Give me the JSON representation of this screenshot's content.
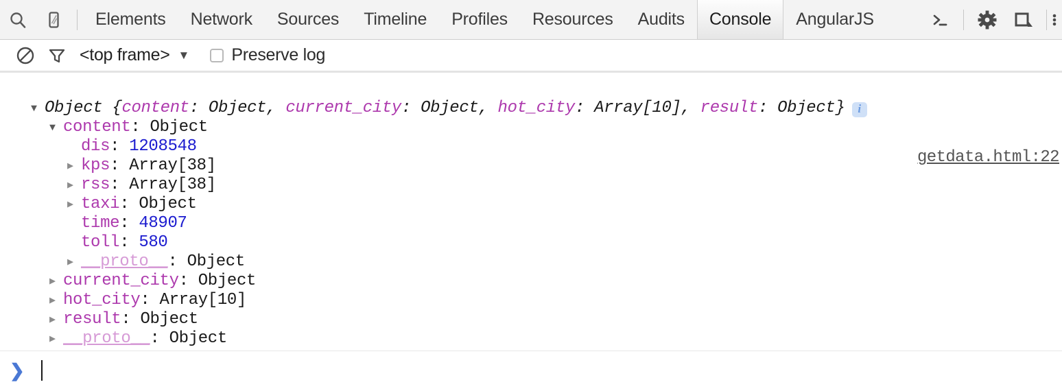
{
  "toolbar": {
    "icons": [
      {
        "name": "search-icon",
        "label": "Search"
      },
      {
        "name": "device-toolbar-icon",
        "label": "Toggle device mode"
      }
    ],
    "tabs": [
      {
        "label": "Elements",
        "active": false
      },
      {
        "label": "Network",
        "active": false
      },
      {
        "label": "Sources",
        "active": false
      },
      {
        "label": "Timeline",
        "active": false
      },
      {
        "label": "Profiles",
        "active": false
      },
      {
        "label": "Resources",
        "active": false
      },
      {
        "label": "Audits",
        "active": false
      },
      {
        "label": "Console",
        "active": true
      },
      {
        "label": "AngularJS",
        "active": false
      }
    ],
    "right_icons": [
      {
        "name": "console-drawer-icon",
        "label": "Show console drawer"
      },
      {
        "name": "gear-icon",
        "label": "Settings"
      },
      {
        "name": "dock-panel-icon",
        "label": "Dock side"
      },
      {
        "name": "more-vertical-icon",
        "label": "More"
      }
    ]
  },
  "filterbar": {
    "clear_icon": "clear-console-icon",
    "filter_icon": "filter-icon",
    "frame_label": "<top frame>",
    "frame_arrow": "▼",
    "preserve_log_label": "Preserve log",
    "preserve_log_checked": false
  },
  "console": {
    "source_link": "getdata.html:22",
    "header": {
      "type": "Object",
      "open_brace": " {",
      "close_brace": "}",
      "preview": [
        {
          "key": "content",
          "value": "Object",
          "sep": ", "
        },
        {
          "key": "current_city",
          "value": "Object",
          "sep": ", "
        },
        {
          "key": "hot_city",
          "value": "Array[10]",
          "sep": ", "
        },
        {
          "key": "result",
          "value": "Object",
          "sep": ""
        }
      ]
    },
    "rows": [
      {
        "indent": 1,
        "marker": "open",
        "key": "content",
        "key_style": "prop",
        "value": "Object",
        "value_style": "obj"
      },
      {
        "indent": 2,
        "marker": "none",
        "key": "dis",
        "key_style": "prop",
        "value": "1208548",
        "value_style": "num"
      },
      {
        "indent": 2,
        "marker": "closed",
        "key": "kps",
        "key_style": "prop",
        "value": "Array[38]",
        "value_style": "obj"
      },
      {
        "indent": 2,
        "marker": "closed",
        "key": "rss",
        "key_style": "prop",
        "value": "Array[38]",
        "value_style": "obj"
      },
      {
        "indent": 2,
        "marker": "closed",
        "key": "taxi",
        "key_style": "prop",
        "value": "Object",
        "value_style": "obj"
      },
      {
        "indent": 2,
        "marker": "none",
        "key": "time",
        "key_style": "prop",
        "value": "48907",
        "value_style": "num"
      },
      {
        "indent": 2,
        "marker": "none",
        "key": "toll",
        "key_style": "prop",
        "value": "580",
        "value_style": "num"
      },
      {
        "indent": 2,
        "marker": "closed",
        "key": "__proto__",
        "key_style": "proto",
        "value": "Object",
        "value_style": "obj"
      },
      {
        "indent": 1,
        "marker": "closed",
        "key": "current_city",
        "key_style": "prop",
        "value": "Object",
        "value_style": "obj"
      },
      {
        "indent": 1,
        "marker": "closed",
        "key": "hot_city",
        "key_style": "prop",
        "value": "Array[10]",
        "value_style": "obj"
      },
      {
        "indent": 1,
        "marker": "closed",
        "key": "result",
        "key_style": "prop",
        "value": "Object",
        "value_style": "obj"
      },
      {
        "indent": 1,
        "marker": "closed",
        "key": "__proto__",
        "key_style": "proto",
        "value": "Object",
        "value_style": "obj"
      }
    ]
  },
  "prompt": {
    "chevron": "❯",
    "input_value": ""
  },
  "colors": {
    "property": "#ad39ad",
    "proto": "#d69ad6",
    "number": "#1b1bcf",
    "text": "#1a1a1a",
    "toolbar_bg": "#f3f3f3",
    "prompt_blue": "#4a78d4",
    "info_badge": "#cfe0f7"
  }
}
